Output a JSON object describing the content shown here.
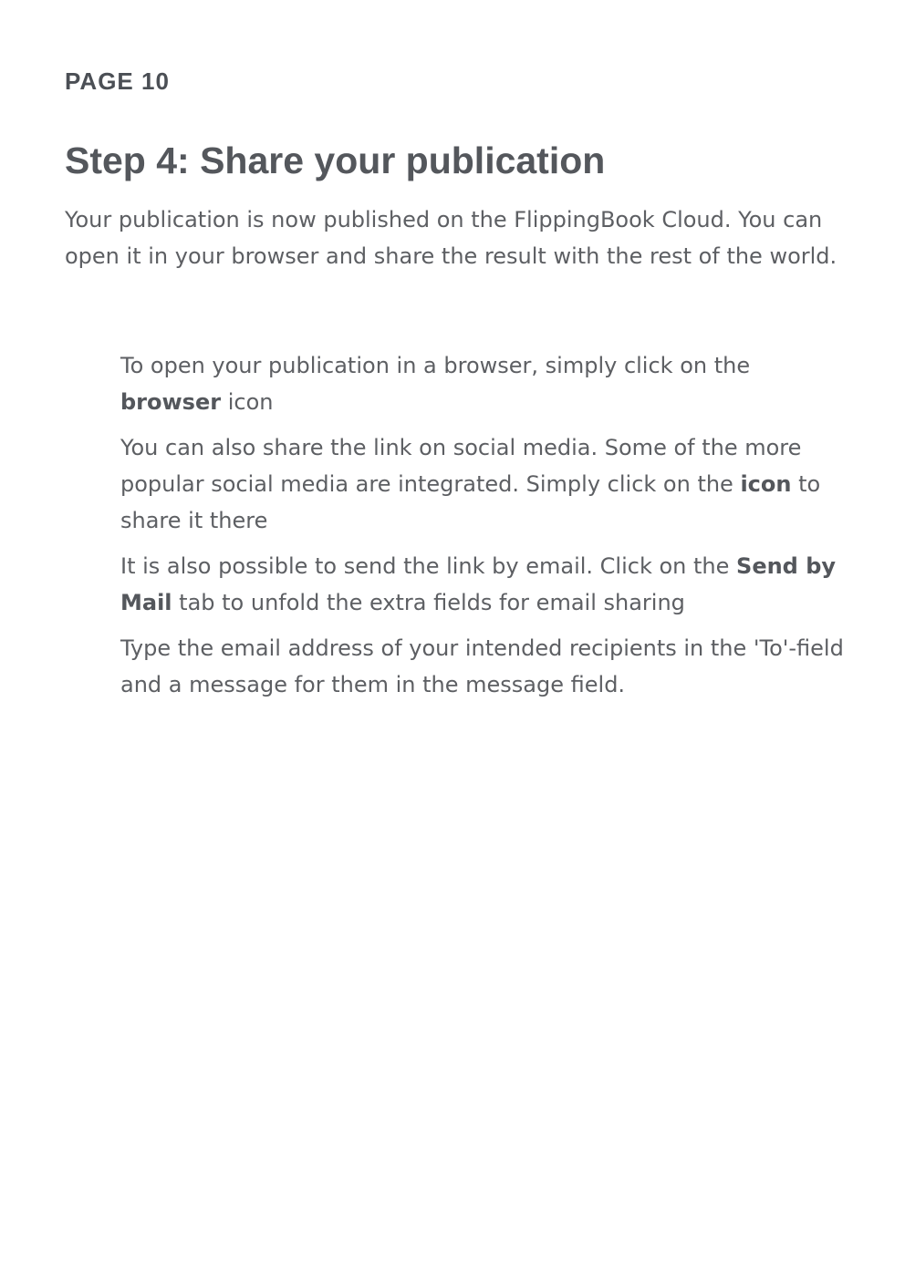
{
  "page": {
    "label": "PAGE 10"
  },
  "section": {
    "title": "Step 4: Share your publication",
    "intro": "Your publication is now published on the FlippingBook Cloud. You can open it in your browser and share the result with the rest of the world."
  },
  "steps": [
    {
      "before": "To open your publication in a browser, simply click on the ",
      "bold": "browser",
      "after": " icon"
    },
    {
      "before": "You can also share the link on social media. Some of the more popular social media are integrated. Simply click on the ",
      "bold": "icon",
      "after": " to share it there"
    },
    {
      "before": "It is also possible to send the link by email. Click on the ",
      "bold": "Send by Mail",
      "after": " tab to unfold the extra fields for email sharing"
    },
    {
      "before": "Type the email address of your intended recipients in the 'To'-field and a message for them in the message field.",
      "bold": "",
      "after": ""
    }
  ]
}
